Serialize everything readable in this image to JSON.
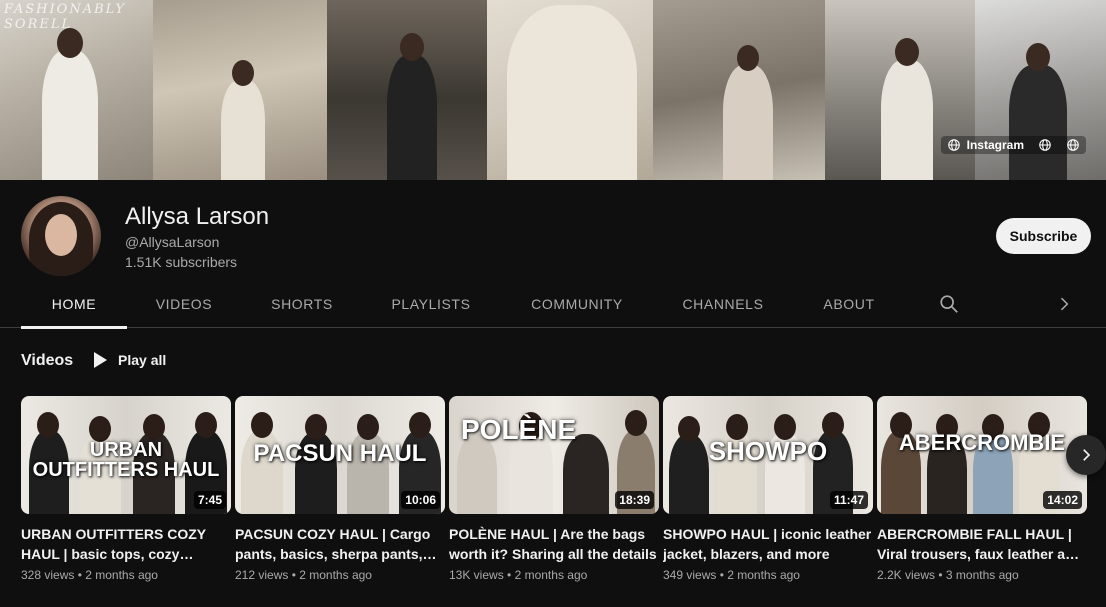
{
  "banner": {
    "overlay_text": "FASHIONABLY SORELL",
    "links": [
      {
        "label": "Instagram",
        "icon": "globe-icon"
      },
      {
        "label": "",
        "icon": "globe-icon"
      },
      {
        "label": "",
        "icon": "globe-icon"
      }
    ]
  },
  "channel": {
    "name": "Allysa Larson",
    "handle": "@AllysaLarson",
    "subscribers": "1.51K subscribers",
    "subscribe_label": "Subscribe"
  },
  "tabs": [
    {
      "label": "HOME",
      "active": true
    },
    {
      "label": "VIDEOS",
      "active": false
    },
    {
      "label": "SHORTS",
      "active": false
    },
    {
      "label": "PLAYLISTS",
      "active": false
    },
    {
      "label": "COMMUNITY",
      "active": false
    },
    {
      "label": "CHANNELS",
      "active": false
    },
    {
      "label": "ABOUT",
      "active": false
    }
  ],
  "videos_section": {
    "title": "Videos",
    "play_all_label": "Play all"
  },
  "videos": [
    {
      "thumb_text": "URBAN OUTFITTERS HAUL",
      "duration": "7:45",
      "title": "URBAN OUTFITTERS COZY HAUL | basic tops, cozy sweaters",
      "views": "328 views",
      "age": "2 months ago"
    },
    {
      "thumb_text": "PACSUN HAUL",
      "duration": "10:06",
      "title": "PACSUN COZY HAUL | Cargo pants, basics, sherpa pants, and more",
      "views": "212 views",
      "age": "2 months ago"
    },
    {
      "thumb_text": "POLÈNE",
      "duration": "18:39",
      "title": "POLÈNE HAUL | Are the bags worth it? Sharing all the details",
      "views": "13K views",
      "age": "2 months ago"
    },
    {
      "thumb_text": "SHOWPO",
      "duration": "11:47",
      "title": "SHOWPO HAUL | iconic leather jacket, blazers, and more",
      "views": "349 views",
      "age": "2 months ago"
    },
    {
      "thumb_text": "ABERCROMBIE",
      "duration": "14:02",
      "title": "ABERCROMBIE FALL HAUL | Viral trousers, faux leather and more",
      "views": "2.2K views",
      "age": "3 months ago"
    }
  ],
  "colors": {
    "background": "#0f0f0f",
    "text_primary": "#f1f1f1",
    "text_secondary": "#aaaaaa",
    "subscribe_bg": "#f1f1f1"
  }
}
